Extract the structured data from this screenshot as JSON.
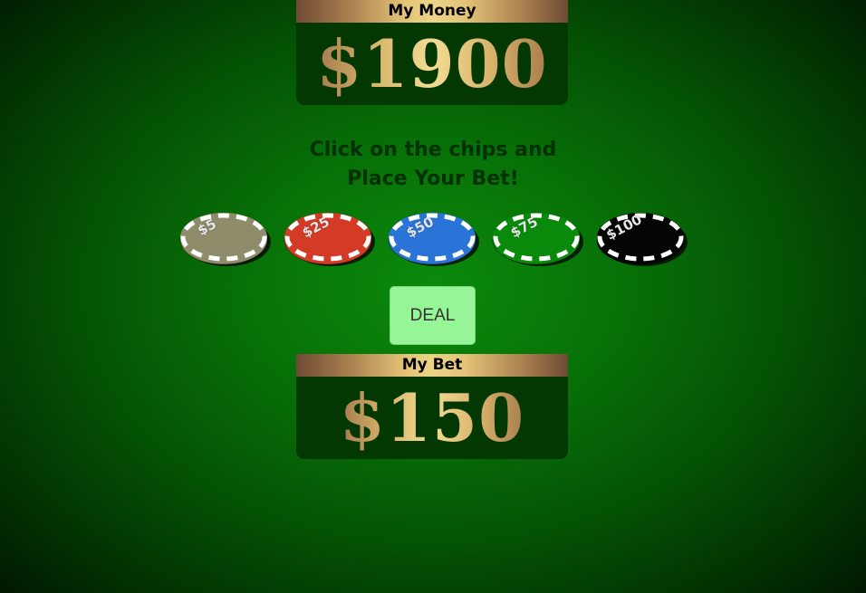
{
  "money": {
    "label": "My Money",
    "amount": "$1900"
  },
  "instructions": {
    "line1": "Click on the chips and",
    "line2": "Place Your Bet!"
  },
  "chips": [
    {
      "label": "$5",
      "color": "#8f8c6b"
    },
    {
      "label": "$25",
      "color": "#d43b27"
    },
    {
      "label": "$50",
      "color": "#2a74d8"
    },
    {
      "label": "$75",
      "color": "#0a8a0a"
    },
    {
      "label": "$100",
      "color": "#050505"
    }
  ],
  "deal": {
    "label": "DEAL"
  },
  "bet": {
    "label": "My Bet",
    "amount": "$150"
  },
  "colors": {
    "table_felt": "#077007",
    "panel_bg": "#033803",
    "gold": "#e3c377",
    "deal_button": "#96f596"
  }
}
